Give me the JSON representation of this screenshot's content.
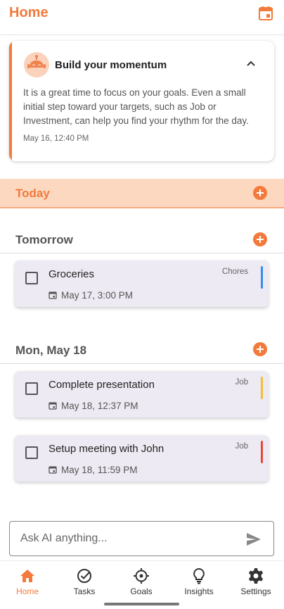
{
  "header": {
    "title": "Home",
    "calendar_icon": "calendar-icon"
  },
  "momentum": {
    "title": "Build your momentum",
    "body": "It is a great time to focus on your goals. Even a small initial step toward your targets, such as Job or Investment, can help you find your rhythm for the day.",
    "timestamp": "May 16, 12:40 PM",
    "avatar_icon": "robot-icon",
    "toggle_icon": "chevron-up-icon"
  },
  "sections": {
    "today": {
      "label": "Today"
    },
    "tomorrow": {
      "label": "Tomorrow"
    },
    "may18": {
      "label": "Mon, May 18"
    }
  },
  "tasks": [
    {
      "title": "Groceries",
      "category": "Chores",
      "date": "May 17, 3:00 PM",
      "color": "#2f8ef0"
    },
    {
      "title": "Complete presentation",
      "category": "Job",
      "date": "May 18, 12:37 PM",
      "color": "#f5bf2a"
    },
    {
      "title": "Setup meeting with John",
      "category": "Job",
      "date": "May 18, 11:59 PM",
      "color": "#e8453c"
    }
  ],
  "ask": {
    "placeholder": "Ask AI anything...",
    "send_icon": "send-icon"
  },
  "nav": [
    {
      "label": "Home",
      "icon": "home-icon",
      "active": true
    },
    {
      "label": "Tasks",
      "icon": "check-circle-icon",
      "active": false
    },
    {
      "label": "Goals",
      "icon": "crosshair-icon",
      "active": false
    },
    {
      "label": "Insights",
      "icon": "lightbulb-icon",
      "active": false
    },
    {
      "label": "Settings",
      "icon": "gear-icon",
      "active": false
    }
  ],
  "colors": {
    "accent": "#f27a3c",
    "today_bg": "#fdd8c1",
    "task_bg": "#eeeaf3"
  }
}
